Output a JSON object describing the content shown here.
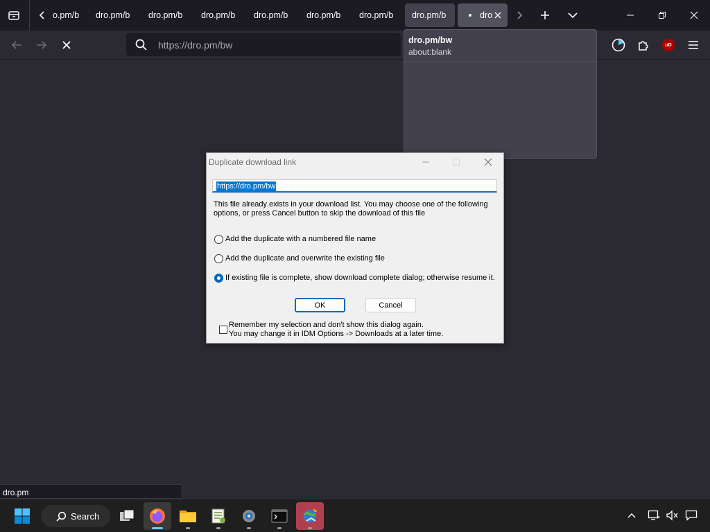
{
  "tabs": [
    {
      "label": "o.pm/b"
    },
    {
      "label": "dro.pm/b"
    },
    {
      "label": "dro.pm/b"
    },
    {
      "label": "dro.pm/b"
    },
    {
      "label": "dro.pm/b"
    },
    {
      "label": "dro.pm/b"
    },
    {
      "label": "dro.pm/b"
    },
    {
      "label": "dro.pm/b"
    },
    {
      "label": "dro"
    }
  ],
  "toolbar": {
    "url": "https://dro.pm/bw",
    "ublock_badge": "uD"
  },
  "tab_preview": {
    "title": "dro.pm/bw",
    "url": "about:blank"
  },
  "dialog": {
    "title": "Duplicate download link",
    "url": "https://dro.pm/bw",
    "message_line1": "This file already exists in your download list. You may choose one of the following",
    "message_line2": "options, or press Cancel button to skip the download of this file",
    "options": [
      {
        "label": "Add the duplicate with a numbered file name",
        "selected": false
      },
      {
        "label": "Add the duplicate and overwrite the existing file",
        "selected": false
      },
      {
        "label": "If existing file is complete, show download complete dialog; otherwise resume it.",
        "selected": true
      }
    ],
    "ok_label": "OK",
    "cancel_label": "Cancel",
    "remember_line1": "Remember my selection and don't show this dialog again.",
    "remember_line2": "You may change it in IDM Options -> Downloads at a later time.",
    "remember_checked": false
  },
  "status_text": "dro.pm",
  "taskbar": {
    "search_label": "Search",
    "apps": [
      "task-view",
      "firefox",
      "file-explorer",
      "notepad-plus-plus",
      "settings",
      "terminal",
      "internet-download-manager"
    ]
  },
  "colors": {
    "browser_chrome": "#1c1b22",
    "content_bg": "#2b2a33",
    "dialog_bg": "#f0f0f0",
    "selection_blue": "#0078d7",
    "accent_blue": "#0067c0",
    "ublock_red": "#b00000"
  }
}
